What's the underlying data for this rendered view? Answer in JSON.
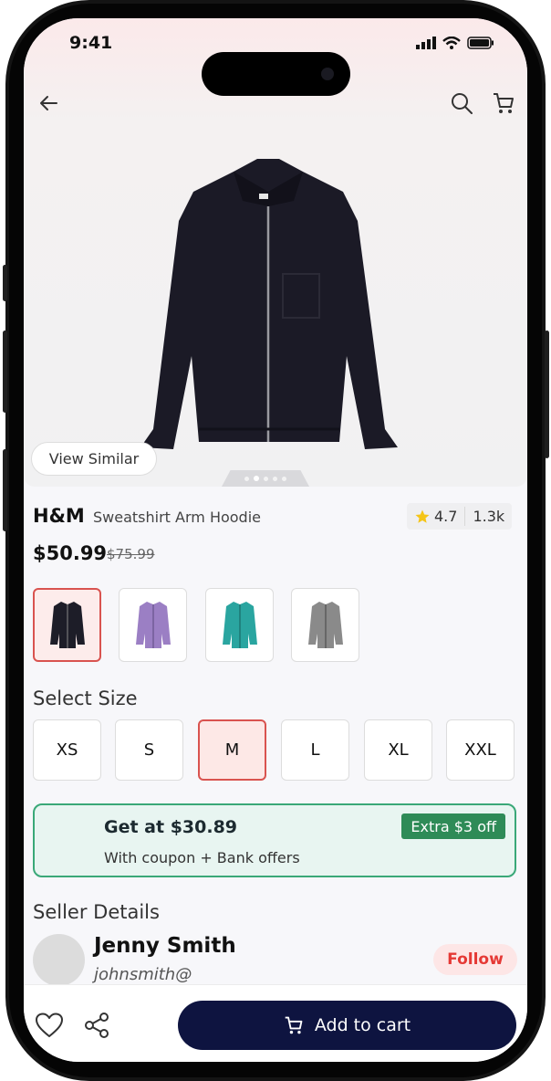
{
  "status": {
    "time": "9:41"
  },
  "product": {
    "brand": "H&M",
    "name": "Sweatshirt Arm Hoodie",
    "rating": "4.7",
    "reviews": "1.3k",
    "price": "$50.99",
    "old_price": "$75.99",
    "view_similar_label": "View Similar",
    "image_count": 5,
    "active_image": 1
  },
  "colors": [
    {
      "name": "black",
      "hex": "#1d1d28",
      "selected": true
    },
    {
      "name": "purple",
      "hex": "#9b7fc4",
      "selected": false
    },
    {
      "name": "teal",
      "hex": "#2aa5a0",
      "selected": false
    },
    {
      "name": "gray",
      "hex": "#8a8a8a",
      "selected": false
    }
  ],
  "size_section": {
    "title": "Select Size",
    "sizes": [
      "XS",
      "S",
      "M",
      "L",
      "XL",
      "XXL"
    ],
    "selected": "M"
  },
  "offer": {
    "title": "Get at $30.89",
    "subtitle": "With coupon + Bank offers",
    "badge": "Extra $3 off"
  },
  "seller": {
    "section_title": "Seller Details",
    "name": "Jenny Smith",
    "handle": "johnsmith@",
    "follow_label": "Follow"
  },
  "actions": {
    "add_to_cart_label": "Add to cart"
  },
  "theme": {
    "primary": "#0e1440",
    "selected_border": "#d9534f",
    "offer_green": "#3aa878"
  }
}
